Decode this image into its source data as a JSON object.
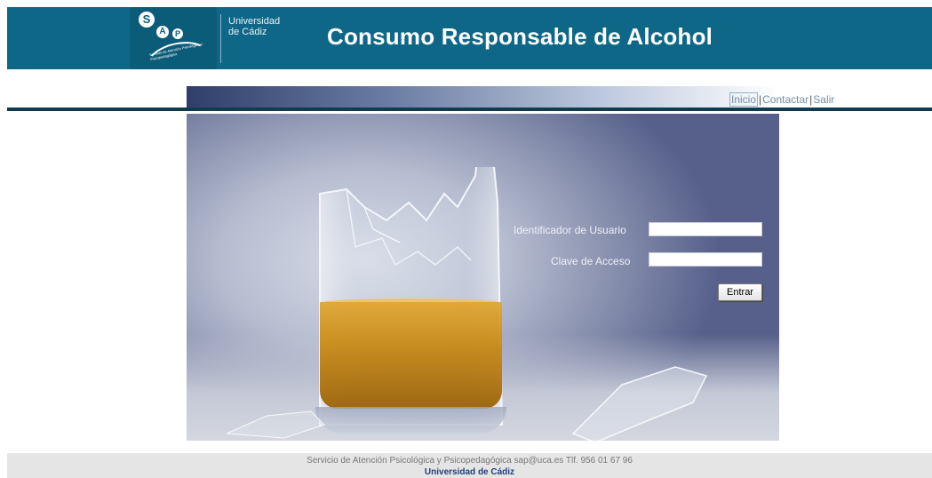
{
  "header": {
    "logo_letters": [
      "S",
      "A",
      "P"
    ],
    "logo_arc_text": "Servicio de Atención Psicológica y Psicopedagógica",
    "university_line1": "Universidad",
    "university_line2": "de Cádiz",
    "site_title": "Consumo Responsable de Alcohol",
    "bg_color": "#0f6787"
  },
  "nav": {
    "items": [
      {
        "label": "Inicio"
      },
      {
        "label": "Contactar"
      },
      {
        "label": "Salir"
      }
    ],
    "separator": "|"
  },
  "login": {
    "user_label": "Identificador de Usuario",
    "user_value": "",
    "password_label": "Clave de Acceso",
    "password_value": "",
    "submit_label": "Entrar"
  },
  "footer": {
    "line1": "Servicio de Atención Psicológica y Psicopedagógica sap@uca.es Tlf. 956 01 67 96",
    "line2": "Universidad de Cádiz"
  }
}
